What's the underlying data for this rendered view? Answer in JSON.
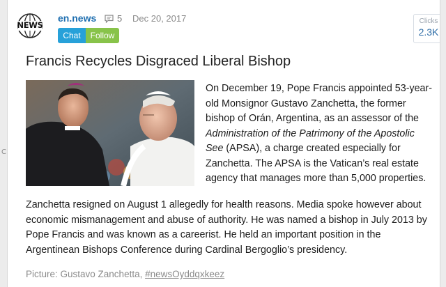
{
  "outside_fragment": "C",
  "post": {
    "avatar_text": "NEWS",
    "source": "en.news",
    "comment_count": "5",
    "date": "Dec 20, 2017",
    "buttons": {
      "chat": "Chat",
      "follow": "Follow"
    },
    "clicks": {
      "label": "Clicks",
      "value": "2.3K"
    },
    "title": "Francis Recycles Disgraced Liberal Bishop",
    "paragraph1": {
      "before": "On December 19, Pope Francis appointed 53-year-old Monsignor Gustavo Zanchetta, the former bishop of Orán, Argentina, as an assessor of the ",
      "italic": "Administration of the Patrimony of the Apostolic See",
      "after": " (APSA), a charge created especially for Zanchetta. The APSA is the Vatican’s real estate agency that manages more than 5,000 properties."
    },
    "paragraph2": "Zanchetta resigned on August 1 allegedly for health reasons. Media spoke however about economic mismanagement and abuse of authority. He was named a bishop in July 2013 by Pope Francis and was known as a careerist. He held an important position in the Argentinean Bishops Conference during Cardinal Bergoglio’s presidency.",
    "caption": {
      "text": "Picture: Gustavo Zanchetta, ",
      "link": "#newsOyddqxkeez"
    }
  },
  "colors": {
    "source": "#1f6fb0",
    "chat": "#27a1d9",
    "follow": "#88c34a",
    "clicks_value": "#2f6ea8"
  }
}
